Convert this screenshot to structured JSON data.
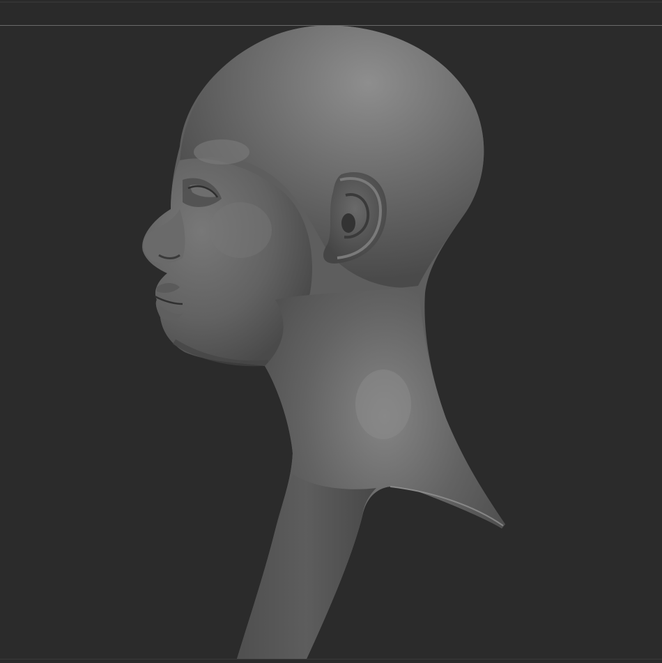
{
  "app": {
    "kind": "3D sculpting viewport",
    "background_color": "#2b2b2b",
    "border_color": "#6a6a6a"
  },
  "viewport": {
    "model": {
      "icon": "sculpted-head-bust",
      "material_color": "#6e6e6e",
      "highlight_color": "#9a9a9a",
      "shadow_color": "#2e2e2e"
    }
  }
}
